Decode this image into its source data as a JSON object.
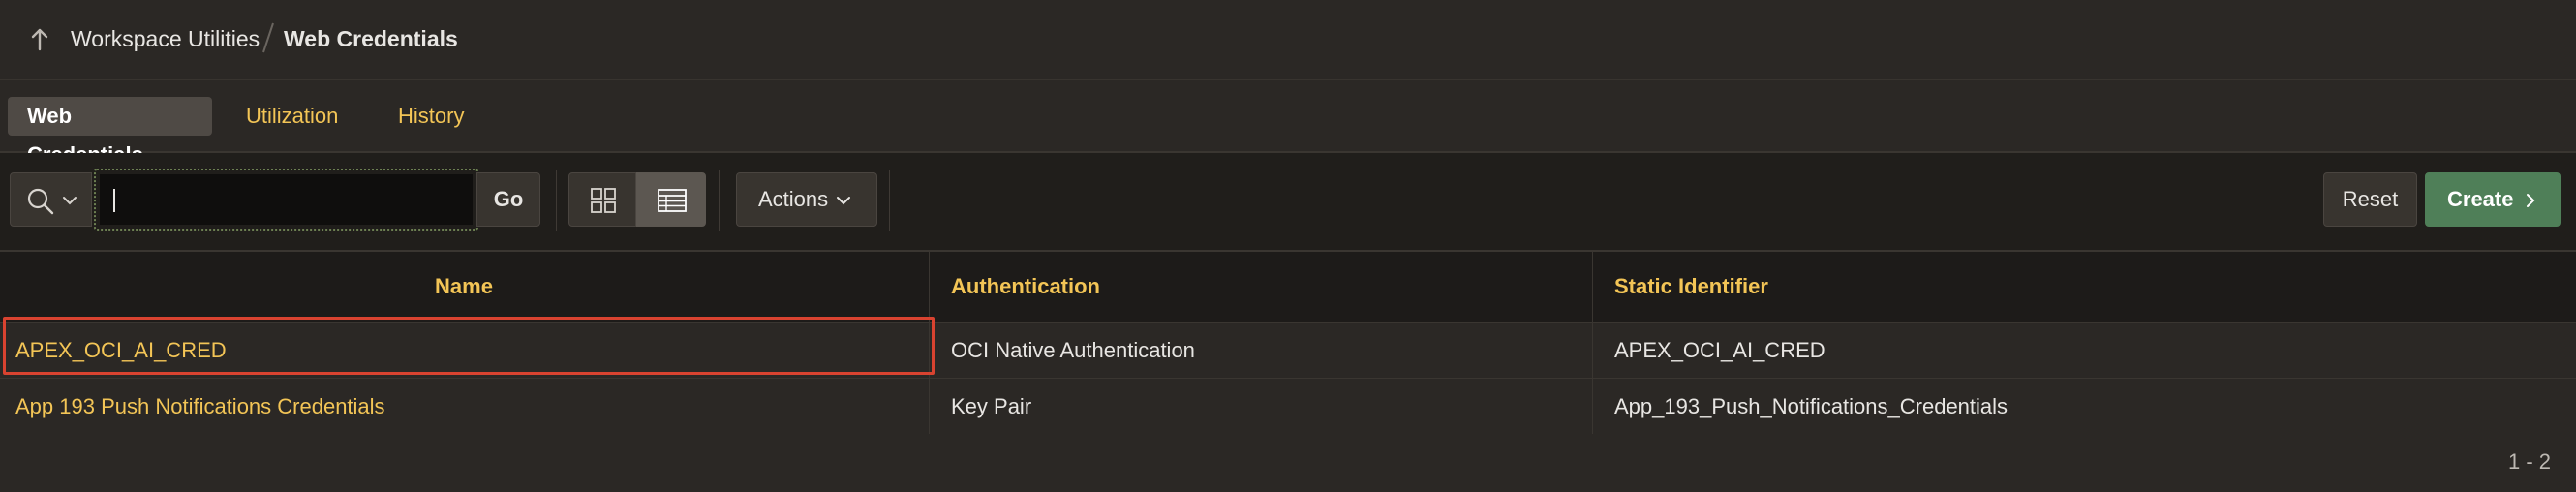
{
  "breadcrumb": {
    "parent": "Workspace Utilities",
    "current": "Web Credentials"
  },
  "tabs": [
    {
      "label": "Web Credentials",
      "active": true
    },
    {
      "label": "Utilization",
      "active": false
    },
    {
      "label": "History",
      "active": false
    }
  ],
  "toolbar": {
    "search_value": "",
    "go_label": "Go",
    "actions_label": "Actions",
    "reset_label": "Reset",
    "create_label": "Create"
  },
  "table": {
    "columns": [
      "Name",
      "Authentication",
      "Static Identifier"
    ],
    "rows": [
      {
        "name": "APEX_OCI_AI_CRED",
        "authentication": "OCI Native Authentication",
        "static_identifier": "APEX_OCI_AI_CRED",
        "highlighted": true
      },
      {
        "name": "App 193 Push Notifications Credentials",
        "authentication": "Key Pair",
        "static_identifier": "App_193_Push_Notifications_Credentials",
        "highlighted": false
      }
    ]
  },
  "pagination": "1 - 2",
  "colors": {
    "accent_link": "#f3c556",
    "create_button": "#4f7f58",
    "highlight": "#d94330"
  },
  "icons": [
    "up-arrow-icon",
    "search-icon",
    "chevron-down-icon",
    "grid-view-icon",
    "report-view-icon",
    "chevron-right-icon"
  ]
}
